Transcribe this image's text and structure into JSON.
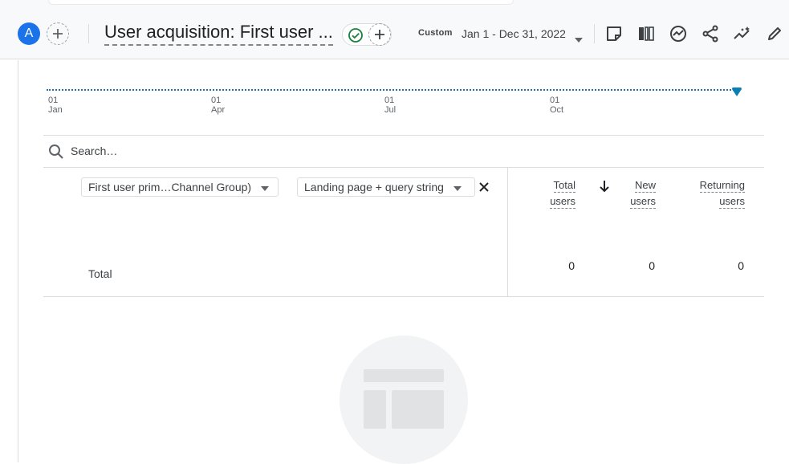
{
  "header": {
    "avatar_letter": "A",
    "report_title": "User acquisition: First user ...",
    "date_preset": "Custom",
    "date_range": "Jan 1 - Dec 31, 2022"
  },
  "timeline": {
    "ticks": [
      {
        "day": "01",
        "month": "Jan"
      },
      {
        "day": "01",
        "month": "Apr"
      },
      {
        "day": "01",
        "month": "Jul"
      },
      {
        "day": "01",
        "month": "Oct"
      }
    ]
  },
  "table": {
    "search_placeholder": "Search…",
    "dimension_primary": "First user prim…Channel Group)",
    "dimension_secondary": "Landing page + query string",
    "columns": [
      {
        "line1": "Total",
        "line2": "users"
      },
      {
        "line1": "New",
        "line2": "users"
      },
      {
        "line1": "Returning",
        "line2": "users"
      }
    ],
    "total_label": "Total",
    "totals": [
      "0",
      "0",
      "0"
    ]
  },
  "colors": {
    "accent": "#1a73e8",
    "success": "#188038",
    "timeline": "#1a73b8"
  }
}
